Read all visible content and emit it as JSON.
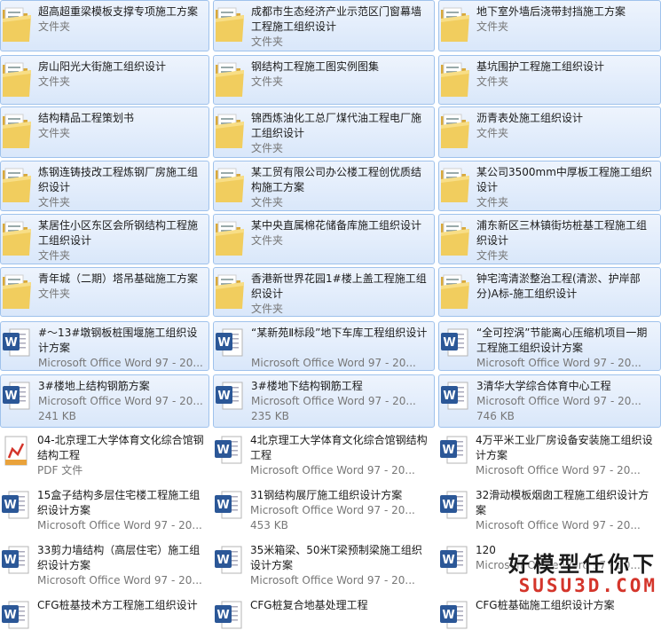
{
  "items": [
    {
      "type": "folder",
      "selected": true,
      "name": "超高超重梁模板支撑专项施工方案",
      "sub": "文件夹",
      "size": ""
    },
    {
      "type": "folder",
      "selected": true,
      "name": "成都市生态经济产业示范区门窗幕墙工程施工组织设计",
      "sub": "文件夹",
      "size": ""
    },
    {
      "type": "folder",
      "selected": true,
      "name": "地下室外墙后浇带封挡施工方案",
      "sub": "文件夹",
      "size": ""
    },
    {
      "type": "folder",
      "selected": true,
      "name": "房山阳光大街施工组织设计",
      "sub": "文件夹",
      "size": ""
    },
    {
      "type": "folder",
      "selected": true,
      "name": "钢结构工程施工图实例图集",
      "sub": "文件夹",
      "size": ""
    },
    {
      "type": "folder",
      "selected": true,
      "name": "基坑围护工程施工组织设计",
      "sub": "文件夹",
      "size": ""
    },
    {
      "type": "folder",
      "selected": true,
      "name": "结构精品工程策划书",
      "sub": "文件夹",
      "size": ""
    },
    {
      "type": "folder",
      "selected": true,
      "name": "锦西炼油化工总厂煤代油工程电厂施工组织设计",
      "sub": "文件夹",
      "size": ""
    },
    {
      "type": "folder",
      "selected": true,
      "name": "沥青表处施工组织设计",
      "sub": "文件夹",
      "size": ""
    },
    {
      "type": "folder",
      "selected": true,
      "name": "炼钢连铸技改工程炼钢厂房施工组织设计",
      "sub": "文件夹",
      "size": ""
    },
    {
      "type": "folder",
      "selected": true,
      "name": "某工贸有限公司办公楼工程创优质结构施工方案",
      "sub": "文件夹",
      "size": ""
    },
    {
      "type": "folder",
      "selected": true,
      "name": "某公司3500mm中厚板工程施工组织设计",
      "sub": "文件夹",
      "size": ""
    },
    {
      "type": "folder",
      "selected": true,
      "name": "某居住小区东区会所钢结构工程施工组织设计",
      "sub": "文件夹",
      "size": ""
    },
    {
      "type": "folder",
      "selected": true,
      "name": "某中央直属棉花储备库施工组织设计",
      "sub": "文件夹",
      "size": ""
    },
    {
      "type": "folder",
      "selected": true,
      "name": "浦东新区三林镇街坊桩基工程施工组织设计",
      "sub": "文件夹",
      "size": ""
    },
    {
      "type": "folder",
      "selected": true,
      "name": "青年城（二期）塔吊基础施工方案",
      "sub": "文件夹",
      "size": ""
    },
    {
      "type": "folder",
      "selected": true,
      "name": "香港新世界花园1#楼上盖工程施工组织设计",
      "sub": "文件夹",
      "size": ""
    },
    {
      "type": "folder",
      "selected": true,
      "name": "钟宅湾清淤整治工程(清淤、护岸部分)A标-施工组织设计",
      "sub": "",
      "size": ""
    },
    {
      "type": "word",
      "selected": true,
      "name": "#～13#墩钢板桩围堰施工组织设计方案",
      "sub": "Microsoft Office Word 97 - 20...",
      "size": ""
    },
    {
      "type": "word",
      "selected": true,
      "name": "“某新苑Ⅱ标段”地下车库工程组织设计",
      "sub": "Microsoft Office Word 97 - 20...",
      "size": ""
    },
    {
      "type": "word",
      "selected": true,
      "name": "“全可控涡”节能离心压缩机项目一期工程施工组织设计方案",
      "sub": "Microsoft Office Word 97 - 20...",
      "size": ""
    },
    {
      "type": "word",
      "selected": true,
      "name": "3#楼地上结构钢筋方案",
      "sub": "Microsoft Office Word 97 - 20...",
      "size": "241 KB"
    },
    {
      "type": "word",
      "selected": true,
      "name": "3#楼地下结构钢筋工程",
      "sub": "Microsoft Office Word 97 - 20...",
      "size": "235 KB"
    },
    {
      "type": "word",
      "selected": true,
      "name": "3清华大学综合体育中心工程",
      "sub": "Microsoft Office Word 97 - 20...",
      "size": "746 KB"
    },
    {
      "type": "pdf",
      "selected": false,
      "name": "04-北京理工大学体育文化综合馆钢结构工程",
      "sub": "PDF 文件",
      "size": ""
    },
    {
      "type": "word",
      "selected": false,
      "name": "4北京理工大学体育文化综合馆钢结构工程",
      "sub": "Microsoft Office Word 97 - 20...",
      "size": ""
    },
    {
      "type": "word",
      "selected": false,
      "name": "4万平米工业厂房设备安装施工组织设计方案",
      "sub": "Microsoft Office Word 97 - 20...",
      "size": ""
    },
    {
      "type": "word",
      "selected": false,
      "name": "15盒子结构多层住宅楼工程施工组织设计方案",
      "sub": "Microsoft Office Word 97 - 20...",
      "size": ""
    },
    {
      "type": "word",
      "selected": false,
      "name": "31钢结构展厅施工组织设计方案",
      "sub": "Microsoft Office Word 97 - 20...",
      "size": "453 KB"
    },
    {
      "type": "word",
      "selected": false,
      "name": "32滑动模板烟囱工程施工组织设计方案",
      "sub": "Microsoft Office Word 97 - 20...",
      "size": ""
    },
    {
      "type": "word",
      "selected": false,
      "name": "33剪力墙结构（高层住宅）施工组织设计方案",
      "sub": "Microsoft Office Word 97 - 20...",
      "size": ""
    },
    {
      "type": "word",
      "selected": false,
      "name": "35米箱梁、50米T梁预制梁施工组织设计方案",
      "sub": "Microsoft Office Word 97 - 20...",
      "size": ""
    },
    {
      "type": "word",
      "selected": false,
      "name": "120",
      "sub": "Microsoft Office Word 97 - 20...",
      "size": ""
    },
    {
      "type": "word",
      "selected": false,
      "name": "CFG桩基技术方工程施工组织设计",
      "sub": "",
      "size": ""
    },
    {
      "type": "word",
      "selected": false,
      "name": "CFG桩复合地基处理工程",
      "sub": "",
      "size": ""
    },
    {
      "type": "word",
      "selected": false,
      "name": "CFG桩基础施工组织设计方案",
      "sub": "",
      "size": ""
    }
  ],
  "watermark": {
    "cn": "好模型任你下",
    "en": "SUSU3D.COM"
  },
  "colors": {
    "selection_bg": "#dce9fa",
    "selection_border": "#9fc2ec",
    "word_blue": "#2b5797",
    "folder_yellow": "#e8c052"
  }
}
